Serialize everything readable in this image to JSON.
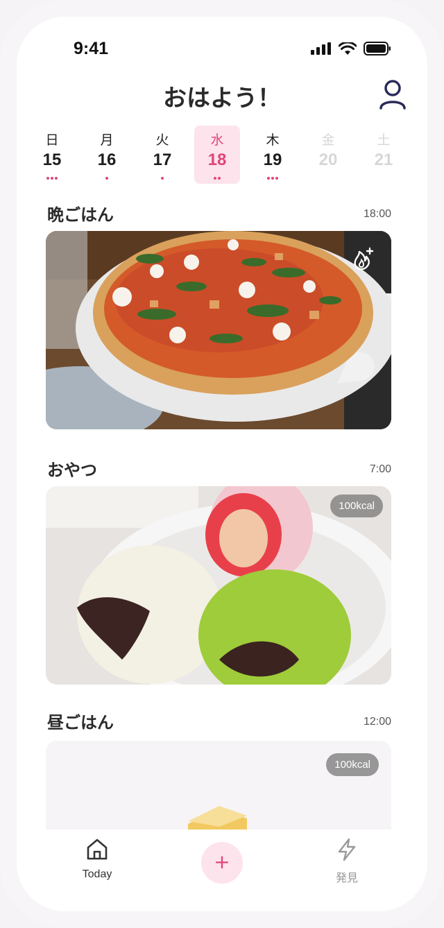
{
  "status_bar": {
    "time": "9:41"
  },
  "header": {
    "greeting": "おはよう！"
  },
  "week": [
    {
      "dow": "日",
      "date": "15",
      "dots": 3,
      "state": "past"
    },
    {
      "dow": "月",
      "date": "16",
      "dots": 1,
      "state": "past"
    },
    {
      "dow": "火",
      "date": "17",
      "dots": 1,
      "state": "past"
    },
    {
      "dow": "水",
      "date": "18",
      "dots": 2,
      "state": "selected"
    },
    {
      "dow": "木",
      "date": "19",
      "dots": 3,
      "state": "past"
    },
    {
      "dow": "金",
      "date": "20",
      "dots": 0,
      "state": "future"
    },
    {
      "dow": "土",
      "date": "21",
      "dots": 0,
      "state": "future"
    }
  ],
  "meals": [
    {
      "title": "晩ごはん",
      "time": "18:00",
      "photo": "pizza-photo",
      "badge": "flame-plus-icon"
    },
    {
      "title": "おやつ",
      "time": "7:00",
      "photo": "daifuku-photo",
      "kcal": "100kcal"
    },
    {
      "title": "昼ごはん",
      "time": "12:00",
      "photo": "toast-photo",
      "kcal": "100kcal"
    }
  ],
  "tabbar": {
    "today_label": "Today",
    "add_label": "+",
    "discover_label": "発見"
  },
  "colors": {
    "accent": "#e0457a",
    "accent_bg": "#fde3ec"
  }
}
